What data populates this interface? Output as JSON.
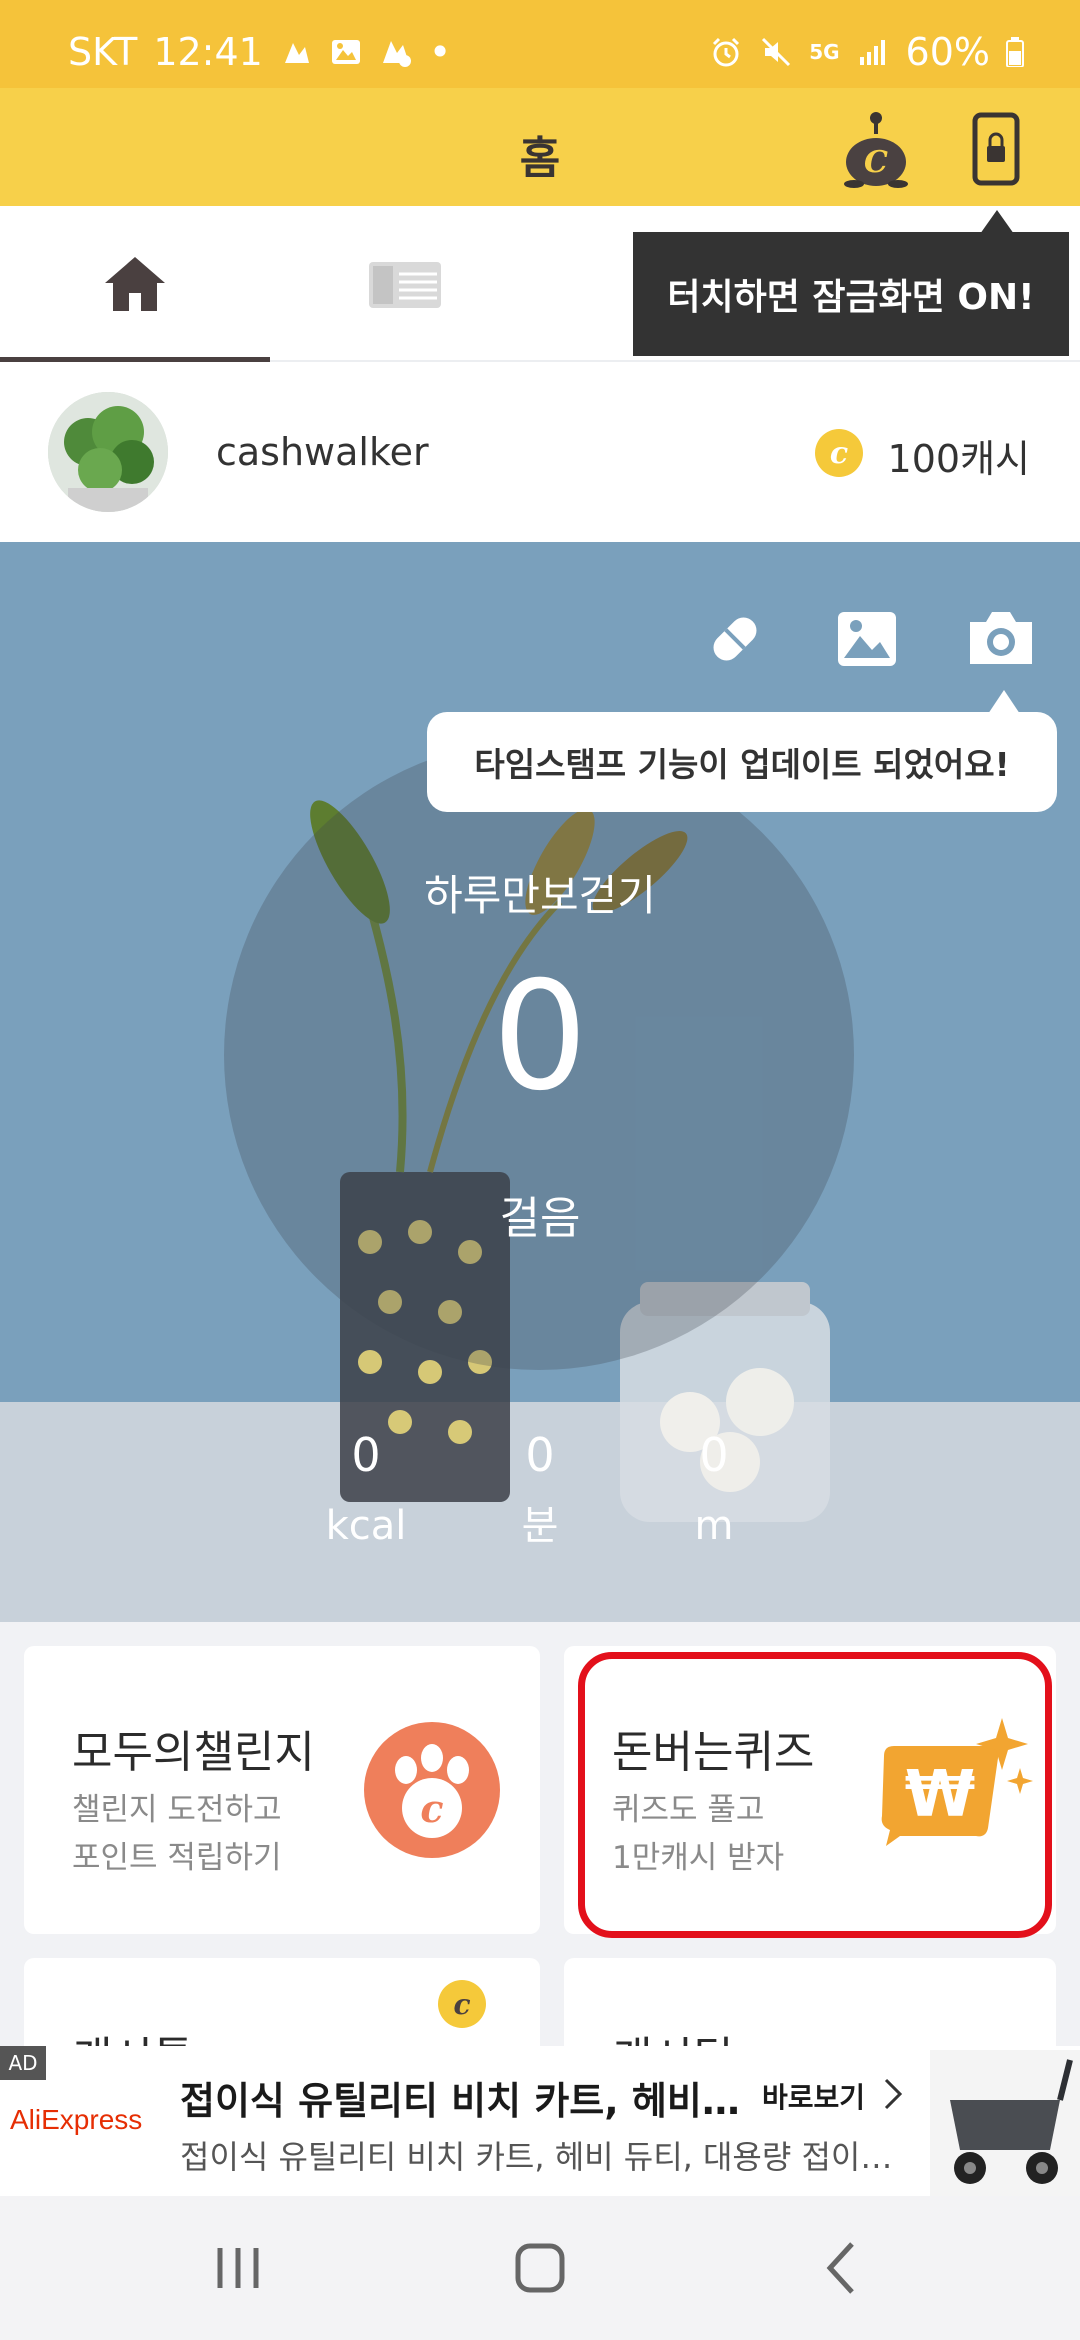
{
  "status_bar": {
    "carrier": "SKT",
    "time": "12:41",
    "dot": "•",
    "network": "5G",
    "battery": "60%"
  },
  "app_bar": {
    "title": "홈"
  },
  "tabs": [
    {
      "name": "home",
      "icon": "home-icon",
      "active": true
    },
    {
      "name": "gift",
      "icon": "gift-icon",
      "active": false
    },
    {
      "name": "shop",
      "icon": "shop-icon",
      "active": false
    },
    {
      "name": "more",
      "icon": "camera-icon",
      "active": false
    }
  ],
  "lock_tooltip": "터치하면 잠금화면 ON!",
  "profile": {
    "username": "cashwalker",
    "cash": "100캐시",
    "coin_letter": "c"
  },
  "hero": {
    "timestamp_tooltip": "타임스탬프 기능이 업데이트 되었어요!",
    "walk_title": "하루만보걷기",
    "steps": "0",
    "steps_unit": "걸음",
    "stats": [
      {
        "value": "0",
        "unit": "kcal"
      },
      {
        "value": "0",
        "unit": "분"
      },
      {
        "value": "0",
        "unit": "m"
      }
    ]
  },
  "cards": [
    {
      "title": "모두의챌린지",
      "sub1": "챌린지 도전하고",
      "sub2": "포인트 적립하기",
      "icon": "paw-coin-icon"
    },
    {
      "title": "돈버는퀴즈",
      "sub1": "퀴즈도 풀고",
      "sub2": "1만캐시 받자",
      "icon": "won-sparkle-icon"
    },
    {
      "title": "캐시톡",
      "icon": "coin-icon"
    },
    {
      "title": "캐시딜"
    }
  ],
  "ad": {
    "tag": "AD",
    "brand": "AliExpress",
    "title": "접이식 유틸리티 비치 카트, 헤비 듀티, 대용량 접이식",
    "description": "접이식 유틸리티 비치 카트, 헤비 듀티, 대용량 접이식 카트",
    "cta": "바로보기"
  },
  "colors": {
    "status_bar": "#f5c33a",
    "app_bar": "#f7d04a",
    "accent_orange": "#ef7f5b",
    "quiz_orange": "#f2a531",
    "highlight_red": "#e3101b"
  }
}
